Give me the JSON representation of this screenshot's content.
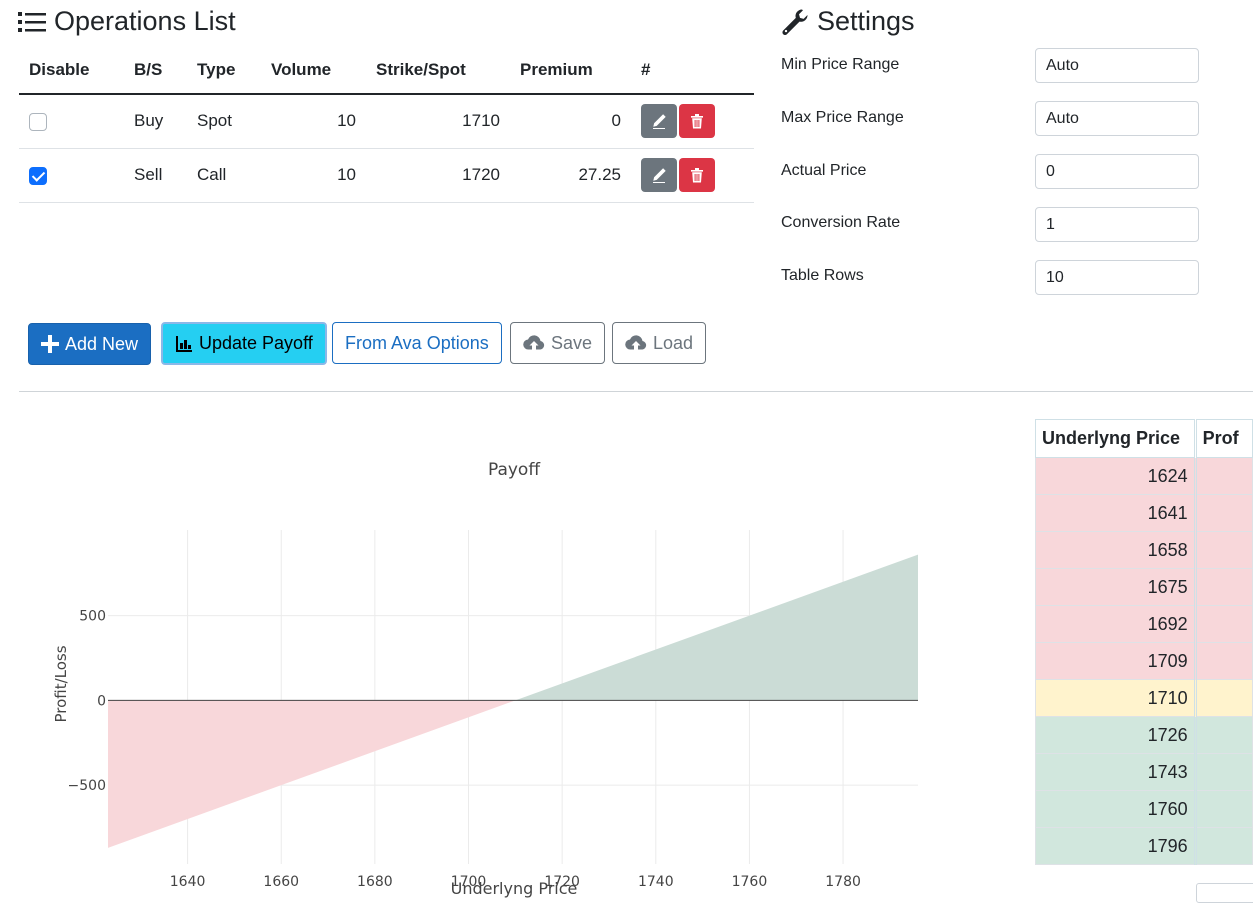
{
  "operations": {
    "title": "Operations List",
    "columns": [
      "Disable",
      "B/S",
      "Type",
      "Volume",
      "Strike/Spot",
      "Premium",
      "#"
    ],
    "rows": [
      {
        "disabled": false,
        "bs": "Buy",
        "type": "Spot",
        "volume": "10",
        "strike": "1710",
        "premium": "0"
      },
      {
        "disabled": true,
        "bs": "Sell",
        "type": "Call",
        "volume": "10",
        "strike": "1720",
        "premium": "27.25"
      }
    ]
  },
  "settings": {
    "title": "Settings",
    "fields": [
      {
        "label": "Min Price Range",
        "value": "Auto"
      },
      {
        "label": "Max Price Range",
        "value": "Auto"
      },
      {
        "label": "Actual Price",
        "value": "0"
      },
      {
        "label": "Conversion Rate",
        "value": "1"
      },
      {
        "label": "Table Rows",
        "value": "10"
      }
    ]
  },
  "toolbar": {
    "add_new": "Add New",
    "update_payoff": "Update Payoff",
    "from_ava": "From Ava Options",
    "save": "Save",
    "load": "Load"
  },
  "colors": {
    "primary": "#1b6ec2",
    "info": "#25cff2",
    "danger": "#dc3545",
    "secondary": "#6c757d",
    "loss_fill": "#f8d7da",
    "gain_fill": "#cbdcd6"
  },
  "chart_data": {
    "type": "area",
    "title": "Payoff",
    "xlabel": "Underlyng Price",
    "ylabel": "Profit/Loss",
    "xlim": [
      1623,
      1796
    ],
    "ylim": [
      -965,
      1005
    ],
    "x_ticks": [
      1640,
      1660,
      1680,
      1700,
      1720,
      1740,
      1760,
      1780
    ],
    "y_ticks": [
      500,
      0,
      -500
    ],
    "y_tick_labels": [
      "500",
      "0",
      "−500"
    ],
    "grid": true,
    "series": [
      {
        "x": [
          1623,
          1710
        ],
        "y": [
          -870,
          0
        ],
        "color": "#f8d7da"
      },
      {
        "x": [
          1710,
          1796
        ],
        "y": [
          0,
          860
        ],
        "color": "#cbdcd6"
      }
    ]
  },
  "results": {
    "columns": [
      "Underlyng Price",
      "Prof"
    ],
    "rows": [
      {
        "price": "1624",
        "status": "loss"
      },
      {
        "price": "1641",
        "status": "loss"
      },
      {
        "price": "1658",
        "status": "loss"
      },
      {
        "price": "1675",
        "status": "loss"
      },
      {
        "price": "1692",
        "status": "loss"
      },
      {
        "price": "1709",
        "status": "loss"
      },
      {
        "price": "1710",
        "status": "even"
      },
      {
        "price": "1726",
        "status": "gain"
      },
      {
        "price": "1743",
        "status": "gain"
      },
      {
        "price": "1760",
        "status": "gain"
      },
      {
        "price": "1796",
        "status": "gain"
      }
    ]
  }
}
